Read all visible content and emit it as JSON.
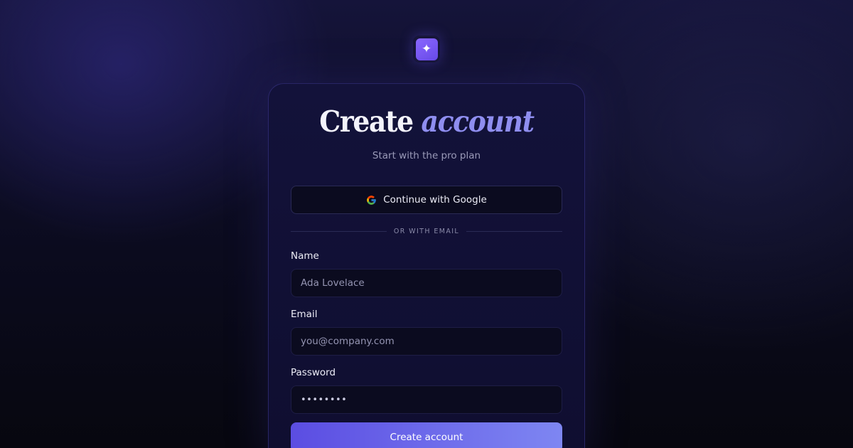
{
  "logo": {
    "glyph": "✦"
  },
  "header": {
    "title_main": "Create",
    "title_accent": "account",
    "subtitle": "Start with the pro plan"
  },
  "oauth": {
    "google_label": "Continue with Google"
  },
  "divider": {
    "text": "OR WITH EMAIL"
  },
  "form": {
    "name_label": "Name",
    "name_placeholder": "Ada Lovelace",
    "email_label": "Email",
    "email_placeholder": "you@company.com",
    "password_label": "Password",
    "password_value": "••••••••",
    "submit_label": "Create account"
  },
  "colors": {
    "accent": "#8f8ef0",
    "button_start": "#5b4de2",
    "button_end": "#7e86f2",
    "background": "#0c0c22"
  }
}
